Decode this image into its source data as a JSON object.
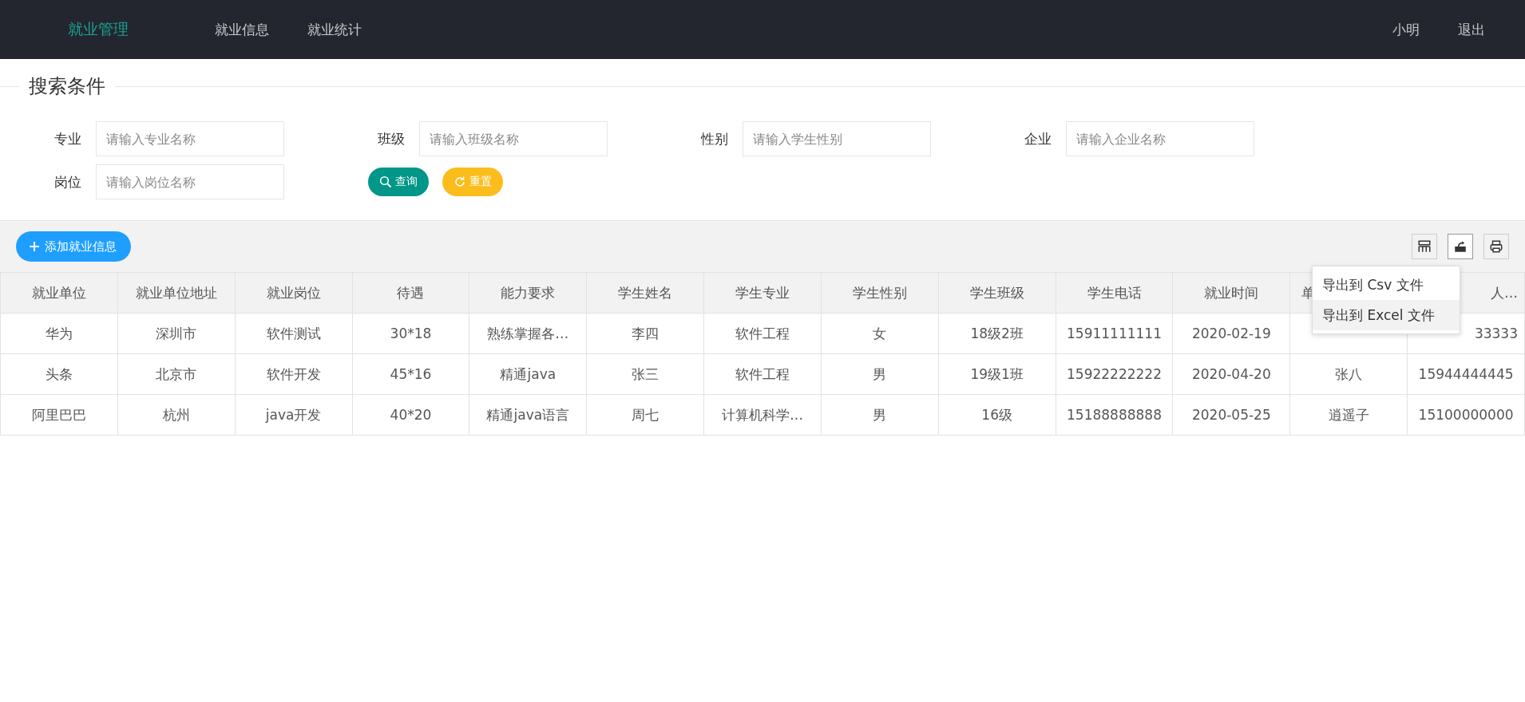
{
  "nav": {
    "brand": "就业管理",
    "items": [
      {
        "label": "就业信息",
        "selected": false
      },
      {
        "label": "就业统计",
        "selected": false
      }
    ],
    "user": "小明",
    "logout": "退出"
  },
  "search": {
    "title": "搜索条件",
    "fields": [
      {
        "label": "专业",
        "placeholder": "请输入专业名称"
      },
      {
        "label": "班级",
        "placeholder": "请输入班级名称"
      },
      {
        "label": "性别",
        "placeholder": "请输入学生性别"
      },
      {
        "label": "企业",
        "placeholder": "请输入企业名称"
      },
      {
        "label": "岗位",
        "placeholder": "请输入岗位名称"
      }
    ],
    "buttons": [
      {
        "kind": "search",
        "label": "查询"
      },
      {
        "kind": "reset",
        "label": "重置"
      }
    ]
  },
  "toolbar": {
    "add_button": "添加就业信息",
    "tools": [
      {
        "kind": "columns",
        "selected": false
      },
      {
        "kind": "export",
        "selected": true
      },
      {
        "kind": "print",
        "selected": false
      }
    ],
    "export_menu": [
      {
        "label": "导出到 Csv 文件",
        "selected": false
      },
      {
        "label": "导出到 Excel 文件",
        "selected": true
      }
    ]
  },
  "table": {
    "columns": [
      "就业单位",
      "就业单位地址",
      "就业岗位",
      "待遇",
      "能力要求",
      "学生姓名",
      "学生专业",
      "学生性别",
      "学生班级",
      "学生电话",
      "就业时间",
      "单",
      "人…"
    ],
    "rows": [
      [
        "华为",
        "深圳市",
        "软件测试",
        "30*18",
        "熟练掌握各…",
        "李四",
        "软件工程",
        "女",
        "18级2班",
        "15911111111",
        "2020-02-19",
        null,
        "33333"
      ],
      [
        "头条",
        "北京市",
        "软件开发",
        "45*16",
        "精通java",
        "张三",
        "软件工程",
        "男",
        "19级1班",
        "15922222222",
        "2020-04-20",
        "张八",
        "15944444445"
      ],
      [
        "阿里巴巴",
        "杭州",
        "java开发",
        "40*20",
        "精通java语言",
        "周七",
        "计算机科学…",
        "男",
        "16级",
        "15188888888",
        "2020-05-25",
        "逍遥子",
        "15100000000"
      ]
    ]
  }
}
